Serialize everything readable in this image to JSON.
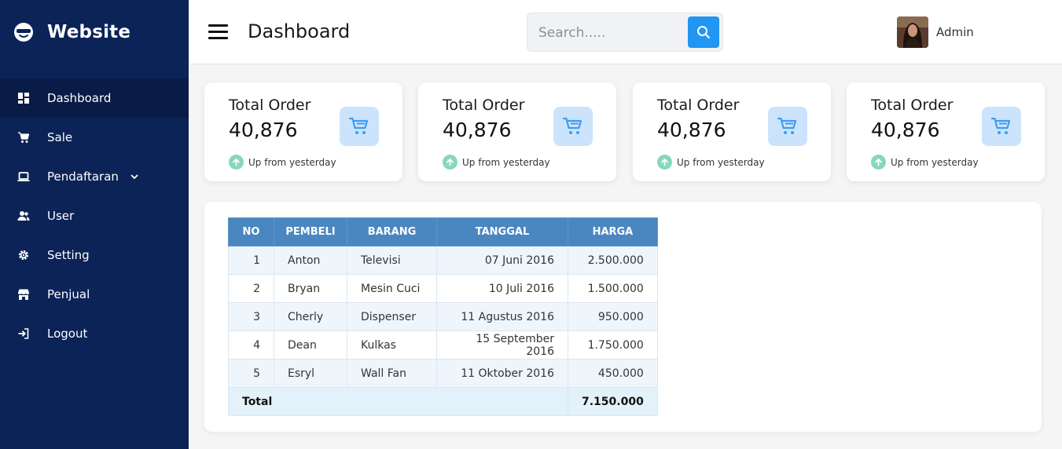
{
  "brand": {
    "name": "Website",
    "icon": "glasses-face-icon"
  },
  "sidebar": {
    "items": [
      {
        "label": "Dashboard",
        "icon": "grid-icon",
        "active": true
      },
      {
        "label": "Sale",
        "icon": "cart-icon"
      },
      {
        "label": "Pendaftaran",
        "icon": "laptop-icon",
        "has_dropdown": true
      },
      {
        "label": "User",
        "icon": "users-icon"
      },
      {
        "label": "Setting",
        "icon": "gear-icon"
      },
      {
        "label": "Penjual",
        "icon": "store-icon"
      },
      {
        "label": "Logout",
        "icon": "logout-icon"
      }
    ]
  },
  "header": {
    "title": "Dashboard",
    "search_placeholder": "Search.....",
    "user_name": "Admin"
  },
  "cards": [
    {
      "title": "Total Order",
      "value": "40,876",
      "note": "Up from yesterday"
    },
    {
      "title": "Total Order",
      "value": "40,876",
      "note": "Up from yesterday"
    },
    {
      "title": "Total Order",
      "value": "40,876",
      "note": "Up from yesterday"
    },
    {
      "title": "Total Order",
      "value": "40,876",
      "note": "Up from yesterday"
    }
  ],
  "table": {
    "headers": [
      "NO",
      "PEMBELI",
      "BARANG",
      "TANGGAL",
      "HARGA"
    ],
    "rows": [
      [
        "1",
        "Anton",
        "Televisi",
        "07 Juni 2016",
        "2.500.000"
      ],
      [
        "2",
        "Bryan",
        "Mesin Cuci",
        "10 Juli 2016",
        "1.500.000"
      ],
      [
        "3",
        "Cherly",
        "Dispenser",
        "11 Agustus 2016",
        "950.000"
      ],
      [
        "4",
        "Dean",
        "Kulkas",
        "15 September 2016",
        "1.750.000"
      ],
      [
        "5",
        "Esryl",
        "Wall Fan",
        "11 Oktober 2016",
        "450.000"
      ]
    ],
    "total_label": "Total",
    "total_value": "7.150.000"
  },
  "colors": {
    "sidebar_bg": "#0b2357",
    "accent": "#2196f3",
    "table_header": "#4a87c0",
    "badge_bg": "#cce4fb",
    "up_indicator": "#88d6c0"
  }
}
